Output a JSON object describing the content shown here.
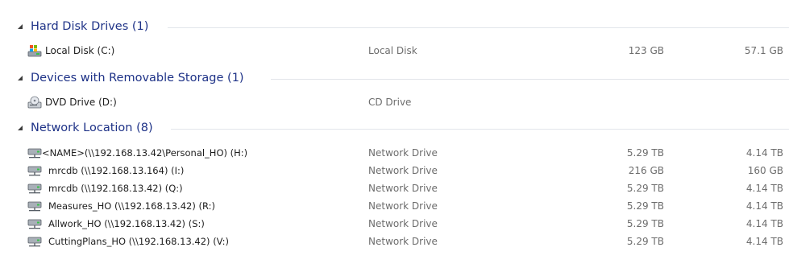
{
  "groups": [
    {
      "title": "Hard Disk Drives (1)",
      "items": [
        {
          "name": "Local Disk (C:)",
          "type": "Local Disk",
          "total": "123 GB",
          "free": "57.1 GB",
          "icon": "local-disk-icon"
        }
      ]
    },
    {
      "title": "Devices with Removable Storage (1)",
      "items": [
        {
          "name": "DVD Drive (D:)",
          "type": "CD Drive",
          "total": "",
          "free": "",
          "icon": "dvd-drive-icon"
        }
      ]
    },
    {
      "title": "Network Location (8)",
      "items": [
        {
          "name": "<NAME>(\\\\192.168.13.42\\Personal_HO) (H:)",
          "type": "Network Drive",
          "total": "5.29 TB",
          "free": "4.14 TB",
          "icon": "network-drive-icon"
        },
        {
          "name": "mrcdb (\\\\192.168.13.164) (I:)",
          "type": "Network Drive",
          "total": "216 GB",
          "free": "160 GB",
          "icon": "network-drive-icon"
        },
        {
          "name": "mrcdb (\\\\192.168.13.42) (Q:)",
          "type": "Network Drive",
          "total": "5.29 TB",
          "free": "4.14 TB",
          "icon": "network-drive-icon"
        },
        {
          "name": "Measures_HO (\\\\192.168.13.42) (R:)",
          "type": "Network Drive",
          "total": "5.29 TB",
          "free": "4.14 TB",
          "icon": "network-drive-icon"
        },
        {
          "name": "Allwork_HO (\\\\192.168.13.42) (S:)",
          "type": "Network Drive",
          "total": "5.29 TB",
          "free": "4.14 TB",
          "icon": "network-drive-icon"
        },
        {
          "name": "CuttingPlans_HO (\\\\192.168.13.42) (V:)",
          "type": "Network Drive",
          "total": "5.29 TB",
          "free": "4.14 TB",
          "icon": "network-drive-icon"
        }
      ]
    }
  ],
  "colors": {
    "group_title": "#1e3287",
    "secondary_text": "#6d6d6d",
    "divider": "#e2e5ea"
  }
}
